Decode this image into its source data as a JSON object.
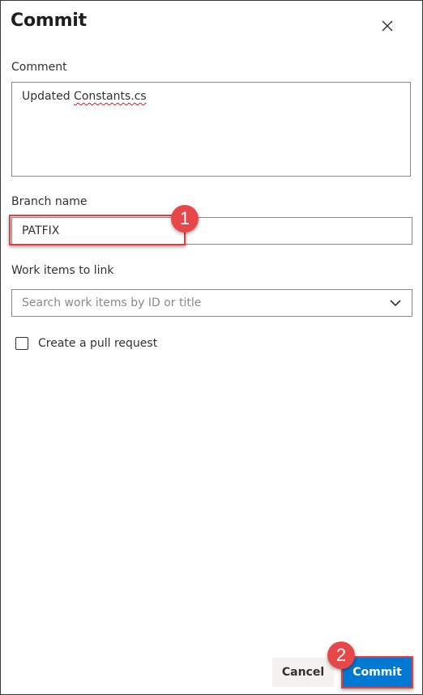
{
  "dialog": {
    "title": "Commit"
  },
  "comment": {
    "label": "Comment",
    "value_prefix": "Updated ",
    "value_misspelled": "Constants.cs"
  },
  "branch": {
    "label": "Branch name",
    "value": "PATFIX"
  },
  "work_items": {
    "label": "Work items to link",
    "placeholder": "Search work items by ID or title"
  },
  "pull_request": {
    "label": "Create a pull request",
    "checked": false
  },
  "footer": {
    "cancel_label": "Cancel",
    "commit_label": "Commit"
  },
  "annotations": {
    "badge_1": "1",
    "badge_2": "2",
    "highlight_color": "#e04040",
    "badge_color": "#e8474a"
  },
  "colors": {
    "primary_button": "#0078d4",
    "border": "#8a8886",
    "text": "#323130",
    "placeholder": "#8a8886"
  },
  "icons": {
    "close": "close-icon",
    "dropdown": "chevron-down-icon",
    "checkbox": "checkbox-icon"
  }
}
